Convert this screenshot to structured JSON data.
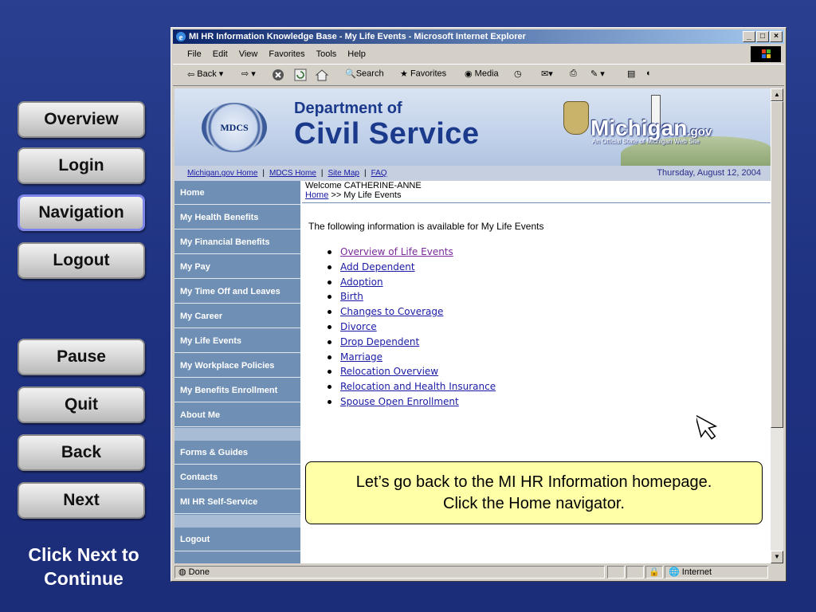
{
  "course_nav": {
    "buttons": [
      "Overview",
      "Login",
      "Navigation",
      "Logout",
      "Pause",
      "Quit",
      "Back",
      "Next"
    ],
    "active": "Navigation",
    "continue_text": "Click Next to Continue"
  },
  "browser": {
    "title": "MI HR Information Knowledge Base - My Life Events - Microsoft Internet Explorer",
    "menu": [
      "File",
      "Edit",
      "View",
      "Favorites",
      "Tools",
      "Help"
    ],
    "toolbar": {
      "back": "Back",
      "search": "Search",
      "favorites": "Favorites",
      "media": "Media"
    },
    "status": {
      "left": "Done",
      "zone": "Internet"
    }
  },
  "banner": {
    "seal_text": "MDCS",
    "dept_line1": "Department of",
    "dept_line2": "Civil Service",
    "michigan_gov": "Michigan",
    "gov_suffix": ".gov",
    "official": "An Official State of Michigan Web Site"
  },
  "linkbar": {
    "links": [
      "Michigan.gov Home",
      "MDCS Home",
      "Site Map",
      "FAQ"
    ],
    "date": "Thursday, August 12, 2004"
  },
  "page_nav": {
    "items": [
      "Home",
      "My Health Benefits",
      "My Financial Benefits",
      "My Pay",
      "My Time Off and Leaves",
      "My Career",
      "My Life Events",
      "My Workplace Policies",
      "My Benefits Enrollment",
      "About Me"
    ],
    "items2": [
      "Forms & Guides",
      "Contacts",
      "MI HR Self-Service"
    ],
    "items3": [
      "Logout"
    ]
  },
  "content": {
    "welcome": "Welcome CATHERINE-ANNE",
    "breadcrumb_home": "Home",
    "breadcrumb_rest": " >> My Life Events",
    "intro": "The following information is available for My Life Events",
    "events": [
      "Overview of Life Events",
      "Add Dependent",
      "Adoption",
      "Birth",
      "Changes to Coverage",
      "Divorce",
      "Drop Dependent",
      "Marriage",
      "Relocation Overview",
      "Relocation and Health Insurance",
      "Spouse Open Enrollment"
    ]
  },
  "callout": {
    "line1": "Let’s go back to the MI HR Information homepage.",
    "line2": "Click the Home navigator."
  }
}
